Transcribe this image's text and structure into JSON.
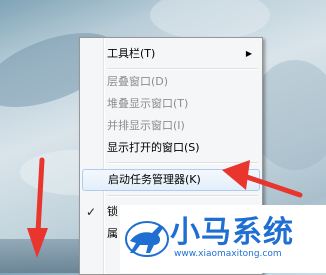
{
  "context_menu": {
    "items": [
      {
        "label": "工具栏(T)",
        "has_submenu": true
      },
      {
        "label": "层叠窗口(D)",
        "disabled": true
      },
      {
        "label": "堆叠显示窗口(T)",
        "disabled": true
      },
      {
        "label": "并排显示窗口(I)",
        "disabled": true
      },
      {
        "label": "显示打开的窗口(S)"
      },
      {
        "label": "启动任务管理器(K)",
        "highlighted": true
      },
      {
        "label": "锁",
        "checked": true,
        "check_symbol": "✓"
      },
      {
        "label": "属"
      }
    ],
    "submenu_arrow": "▶"
  },
  "watermark": {
    "title": "小马系统",
    "url": "www.xiaomaxitong.com",
    "logo_icon": "running-horse-icon"
  },
  "colors": {
    "annotation_arrow": "#e8352e",
    "watermark_blue": "#1e6fd1"
  }
}
